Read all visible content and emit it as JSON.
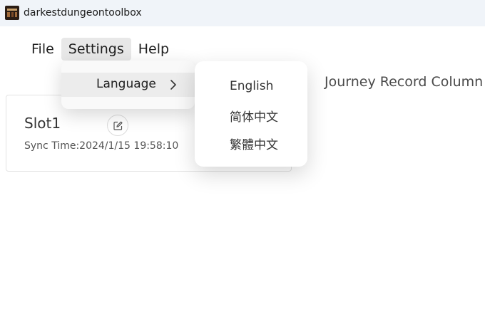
{
  "window": {
    "title": "darkestdungeontoolbox",
    "icon": "app-logo-icon"
  },
  "menubar": {
    "items": [
      {
        "label": "File"
      },
      {
        "label": "Settings"
      },
      {
        "label": "Help"
      }
    ]
  },
  "settings_menu": {
    "items": [
      {
        "label": "Language",
        "icon": "chevron-right-icon"
      }
    ]
  },
  "language_submenu": {
    "items": [
      {
        "label": "English"
      },
      {
        "label": "简体中文"
      },
      {
        "label": "繁體中文"
      }
    ]
  },
  "journey": {
    "label": "Journey Record Column"
  },
  "slot_card": {
    "name": "Slot1",
    "edit_icon": "edit-icon",
    "sync_time": "Sync Time:2024/1/15 19:58:10"
  },
  "colors": {
    "titlebar_bg": "#f0f4f9",
    "menu_active_bg": "#e8e8e8",
    "dropdown_bg": "#f9f9f9"
  }
}
